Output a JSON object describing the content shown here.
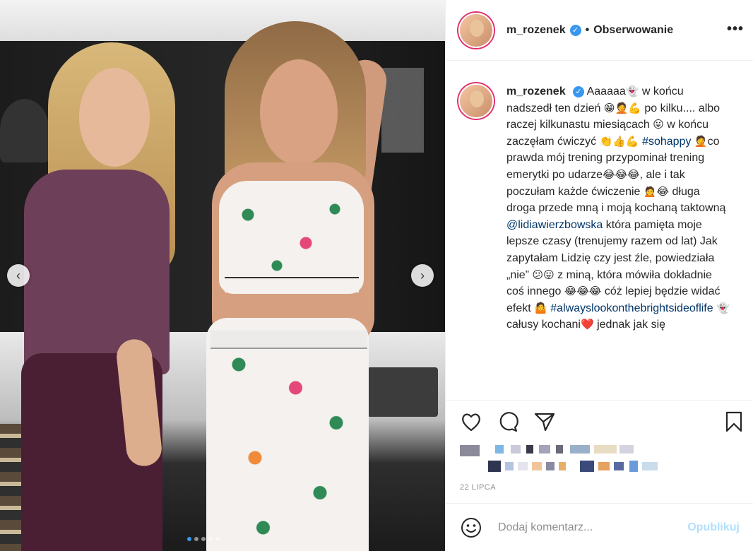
{
  "post": {
    "username": "m_rozenek",
    "follow_label": "Obserwowanie",
    "more_label": "•••",
    "caption": {
      "text_1": "Aaaaaa",
      "emoji_1": "👻",
      "text_2": " w końcu nadszedł ten dzień ",
      "emoji_2": "😁🤦💪",
      "text_3": " po kilku.... albo raczej kilkunastu miesiącach ",
      "emoji_3": "😛",
      "text_4": " w końcu zaczęłam ćwiczyć ",
      "emoji_4": "👏👍💪",
      "hashtag_1": "#sohappy",
      "emoji_5": "🤦",
      "text_5": "co prawda mój trening przypominał trening emerytki po udarze",
      "emoji_6": "😂😂😂",
      "text_6": ", ale i tak poczułam każde ćwiczenie ",
      "emoji_7": "🙍😂",
      "text_7": " długa droga przede mną i moją kochaną taktowną ",
      "mention": "@lidiawierzbowska",
      "text_8": " która pamięta moje lepsze czasy (trenujemy razem od lat) Jak zapytałam Lidzię czy jest źle, powiedziała „nie” ",
      "emoji_8": "😕😛",
      "text_9": " z miną, która mówiła dokładnie coś innego ",
      "emoji_9": "😂😂😂",
      "text_10": " cóż lepiej będzie widać efekt ",
      "emoji_10": "🤷",
      "hashtag_2": "#alwayslookonthebrightsideoflife",
      "emoji_11": "👻",
      "text_11": " całusy kochani",
      "emoji_12": "❤️",
      "text_12": " jednak jak się"
    },
    "date": "22 LIPCA",
    "comment_placeholder": "Dodaj komentarz...",
    "publish_label": "Opublikuj"
  },
  "colors": {
    "verified_blue": "#3897f0",
    "link_blue": "#003569",
    "publish_disabled": "#b2dffc"
  },
  "icons": {
    "nav_prev": "chevron-left-icon",
    "nav_next": "chevron-right-icon",
    "verified": "verified-badge-icon",
    "heart": "heart-icon",
    "comment": "comment-icon",
    "share": "share-icon",
    "save": "bookmark-icon",
    "emoji": "smiley-icon"
  },
  "carousel": {
    "slide_count": 5,
    "active_slide": 1
  }
}
